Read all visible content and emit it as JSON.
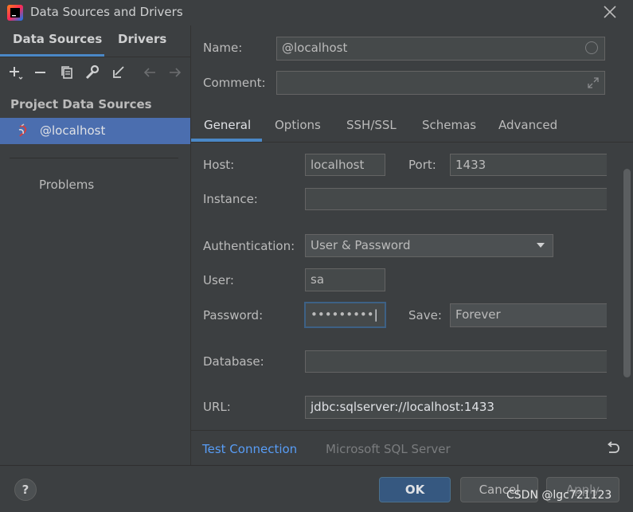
{
  "window": {
    "title": "Data Sources and Drivers",
    "icon": "intellij-idea-icon"
  },
  "left_panel": {
    "tabs": [
      {
        "label": "Data Sources",
        "active": true
      },
      {
        "label": "Drivers",
        "active": false
      }
    ],
    "toolbar": [
      "add-icon",
      "remove-icon",
      "duplicate-icon",
      "wrench-icon",
      "import-icon",
      "arrow-left-icon",
      "arrow-right-icon"
    ],
    "section_title": "Project Data Sources",
    "items": [
      {
        "label": "@localhost",
        "icon": "sql-server-icon",
        "selected": true
      }
    ],
    "problems_label": "Problems"
  },
  "form": {
    "name_label": "Name:",
    "name_value": "@localhost",
    "comment_label": "Comment:",
    "comment_value": ""
  },
  "tabs": [
    {
      "label": "General",
      "active": true
    },
    {
      "label": "Options",
      "active": false
    },
    {
      "label": "SSH/SSL",
      "active": false
    },
    {
      "label": "Schemas",
      "active": false
    },
    {
      "label": "Advanced",
      "active": false
    }
  ],
  "general": {
    "host_label": "Host:",
    "host_value": "localhost",
    "port_label": "Port:",
    "port_value": "1433",
    "instance_label": "Instance:",
    "instance_value": "",
    "auth_label": "Authentication:",
    "auth_value": "User & Password",
    "user_label": "User:",
    "user_value": "sa",
    "password_label": "Password:",
    "password_value": "•••••••••",
    "save_label": "Save:",
    "save_value": "Forever",
    "database_label": "Database:",
    "database_value": "",
    "url_label": "URL:",
    "url_value": "jdbc:sqlserver://localhost:1433"
  },
  "bottom": {
    "test_connection": "Test Connection",
    "driver": "Microsoft SQL Server"
  },
  "footer": {
    "help": "?",
    "ok": "OK",
    "cancel": "Cancel",
    "apply": "Apply"
  },
  "watermark": "CSDN @lgc721123",
  "colors": {
    "background": "#3c3f41",
    "field_bg": "#45494a",
    "accent": "#4a88c7",
    "selection": "#4b6eaf",
    "link": "#589df6",
    "ok_button": "#365880"
  }
}
